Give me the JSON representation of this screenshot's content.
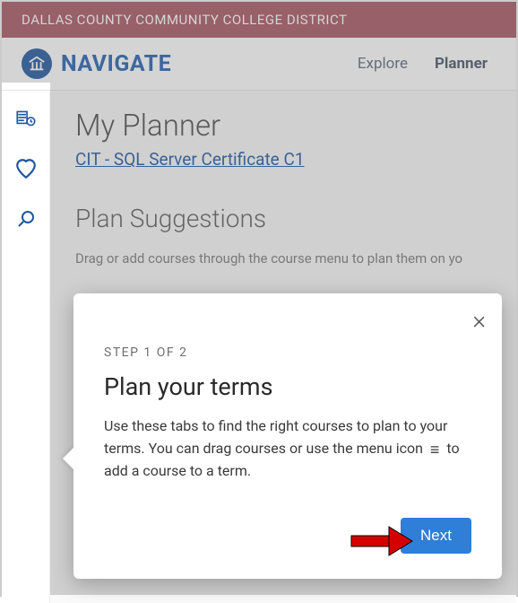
{
  "institution": "DALLAS COUNTY COMMUNITY COLLEGE DISTRICT",
  "brand": "NAVIGATE",
  "nav": {
    "explore": "Explore",
    "planner": "Planner"
  },
  "page": {
    "title": "My Planner",
    "certificate_link": "CIT - SQL Server Certificate C1",
    "suggestions_title": "Plan Suggestions",
    "suggestions_desc": "Drag or add courses through the course menu to plan them on yo"
  },
  "popover": {
    "step_label": "STEP 1 OF 2",
    "title": "Plan your terms",
    "body_part1": "Use these tabs to find the right courses to plan to your terms. You can drag courses or use the menu icon ",
    "body_part2": " to add a course to a term.",
    "next": "Next"
  }
}
